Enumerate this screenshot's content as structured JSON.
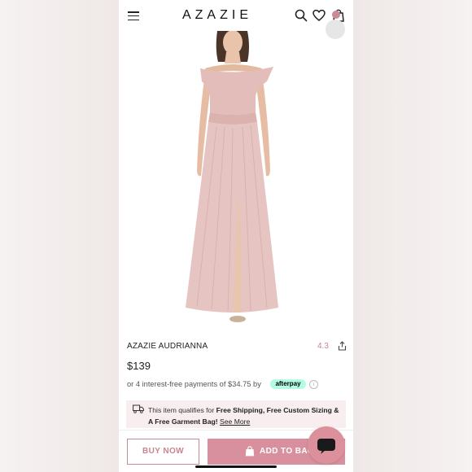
{
  "header": {
    "logo": "AZAZIE",
    "menu_icon": "hamburger-menu-icon",
    "search_icon": "search-icon",
    "wishlist_icon": "heart-icon",
    "bag_icon": "shopping-bag-icon",
    "bag_badge": ""
  },
  "product": {
    "name": "AZAZIE AUDRIANNA",
    "rating": "4.3",
    "price": "$139",
    "afterpay_text": "or 4 interest-free payments of $34.75 by",
    "afterpay_badge": "afterpay",
    "dress_color": "#e5c4c1"
  },
  "shipping": {
    "prefix": "This item qualifies for ",
    "bold": "Free Shipping, Free Custom Sizing & A Free Garment Bag!",
    "link": "See More"
  },
  "actions": {
    "buy_now": "BUY NOW",
    "add_to_bag": "ADD TO BAG"
  },
  "colors": {
    "accent": "#d9909e",
    "accent_text": "#c7858f"
  }
}
